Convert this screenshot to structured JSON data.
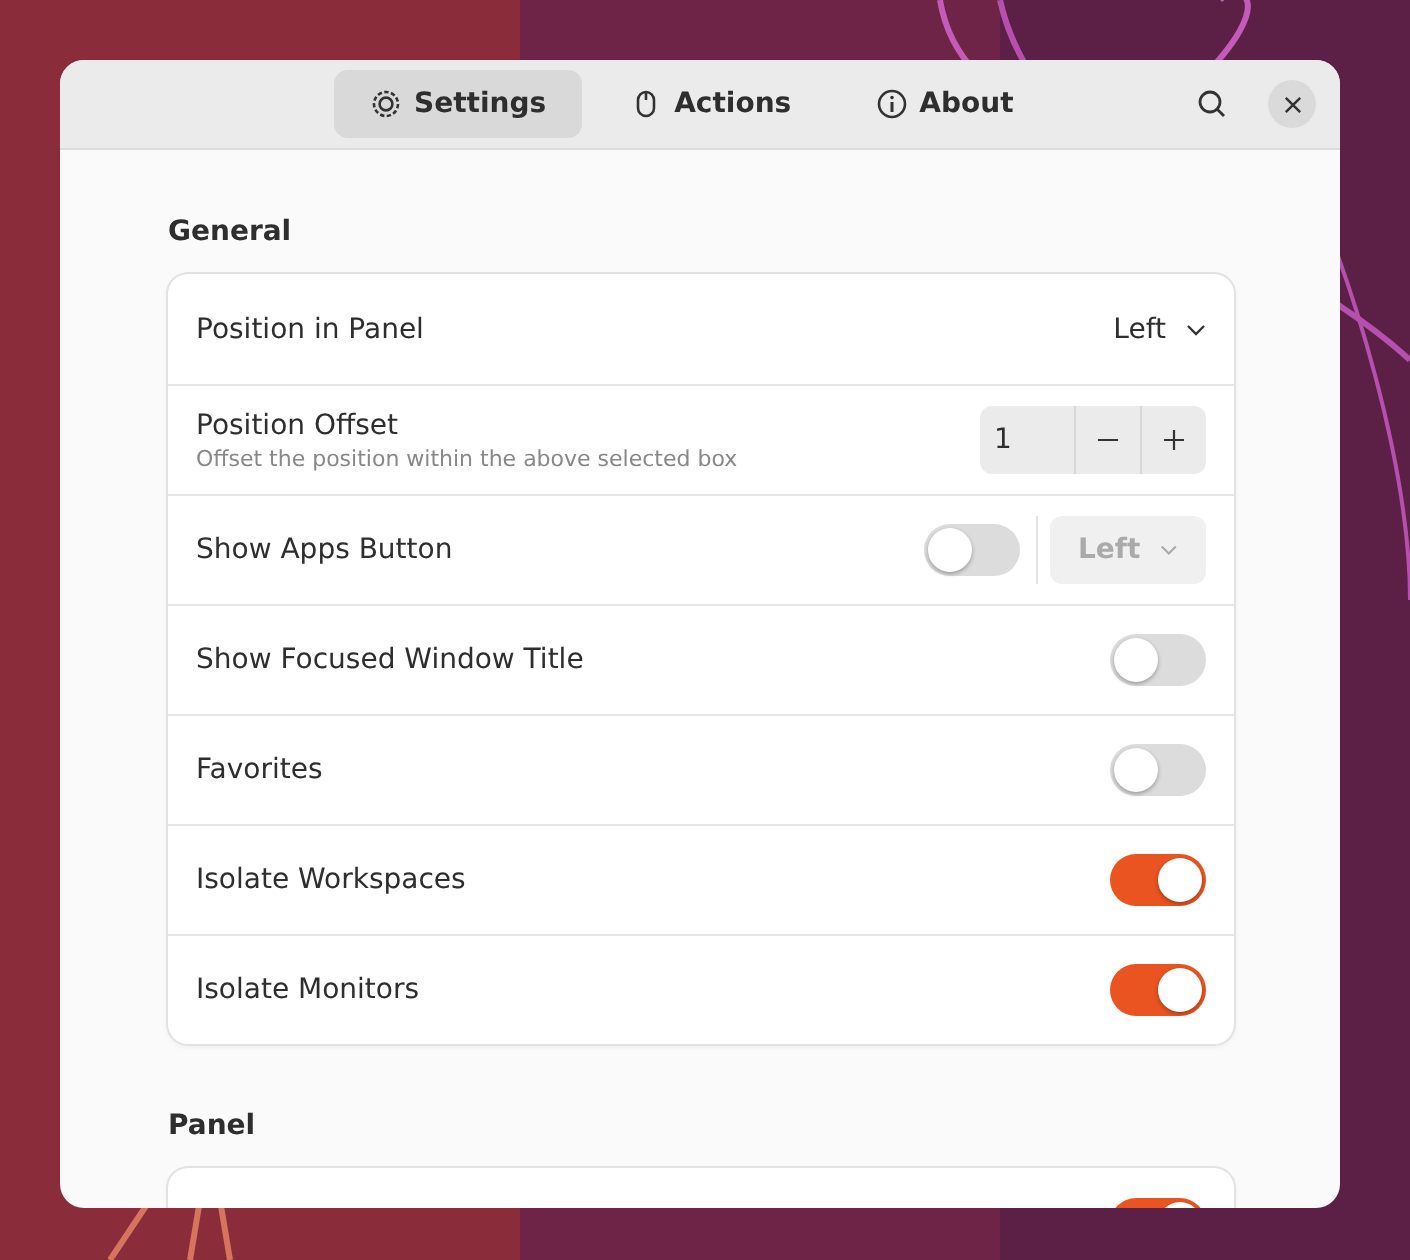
{
  "window": {
    "tabs": [
      {
        "label": "Settings",
        "selected": true
      },
      {
        "label": "Actions",
        "selected": false
      },
      {
        "label": "About",
        "selected": false
      }
    ]
  },
  "sections": [
    {
      "title": "General",
      "rows": [
        {
          "kind": "dropdown",
          "label": "Position in Panel",
          "value": "Left"
        },
        {
          "kind": "spin",
          "label": "Position Offset",
          "description": "Offset the position within the above selected box",
          "value": "1"
        },
        {
          "kind": "switch-dropdown",
          "label": "Show Apps Button",
          "on": false,
          "value": "Left",
          "disabled": true
        },
        {
          "kind": "switch",
          "label": "Show Focused Window Title",
          "on": false
        },
        {
          "kind": "switch",
          "label": "Favorites",
          "on": false
        },
        {
          "kind": "switch",
          "label": "Isolate Workspaces",
          "on": true
        },
        {
          "kind": "switch",
          "label": "Isolate Monitors",
          "on": true
        }
      ]
    },
    {
      "title": "Panel",
      "rows": [
        {
          "kind": "switch",
          "on": true
        }
      ]
    }
  ]
}
